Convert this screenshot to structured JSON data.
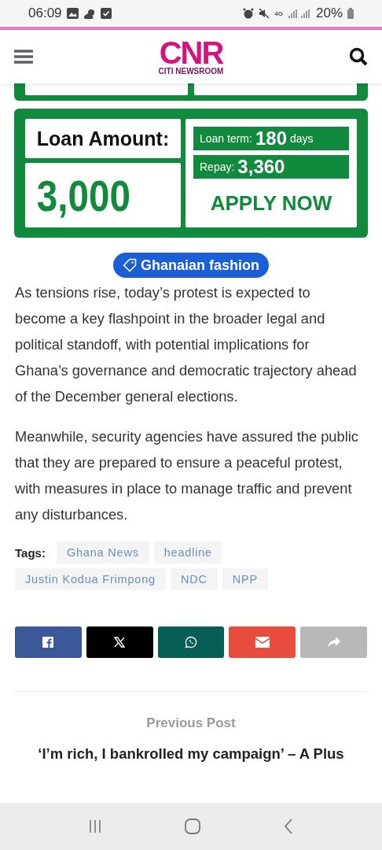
{
  "status_bar": {
    "time": "06:09",
    "network": "4G",
    "battery": "20%"
  },
  "header": {
    "logo": "CNR",
    "logo_subtitle": "CITI NEWSROOM"
  },
  "ad": {
    "amount_label": "Loan Amount:",
    "amount": "3,000",
    "term_label": "Loan term:",
    "term_value": "180",
    "term_unit": "days",
    "repay_label": "Repay:",
    "repay_value": "3,360",
    "cta": "APPLY NOW"
  },
  "category": "Ghanaian fashion",
  "paragraphs": [
    "As tensions rise, today’s protest is expected to become a key flashpoint in the broader legal and political standoff, with potential implications for Ghana’s governance and democratic trajectory ahead of the December general elections.",
    "Meanwhile, security agencies have assured the public that they are prepared to ensure a peaceful protest, with measures in place to manage traffic and prevent any disturbances."
  ],
  "tags": {
    "label": "Tags:",
    "items": [
      "Ghana News",
      "headline",
      "Justin Kodua Frimpong",
      "NDC",
      "NPP"
    ]
  },
  "share": [
    {
      "kind": "facebook",
      "color": "#3b5998"
    },
    {
      "kind": "x",
      "color": "#000000"
    },
    {
      "kind": "whatsapp",
      "color": "#075e54"
    },
    {
      "kind": "email",
      "color": "#e74c3c"
    },
    {
      "kind": "share",
      "color": "#b8b8b8"
    }
  ],
  "previous_post": {
    "label": "Previous Post",
    "title": "‘I’m rich, I bankrolled my campaign’ – A Plus"
  }
}
